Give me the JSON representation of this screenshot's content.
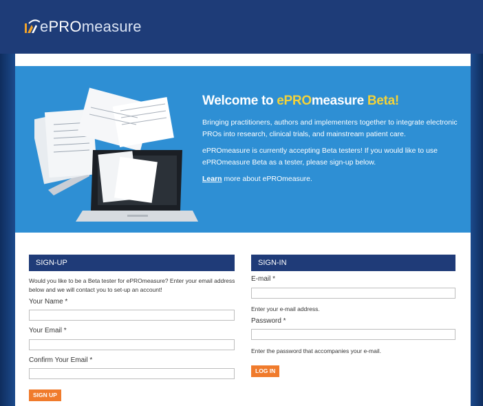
{
  "brand": {
    "name_prefix": "e",
    "name_highlight": "PRO",
    "name_suffix": "measure"
  },
  "hero": {
    "title_white": "Welcome to ",
    "title_yellow_1": "ePRO",
    "title_white_2": "measure ",
    "title_yellow_2": "Beta!",
    "p1": "Bringing practitioners, authors and implementers together to integrate electronic PROs into research, clinical trials, and mainstream patient care.",
    "p2": "ePROmeasure is currently accepting Beta testers! If you would like to use ePROmeasure Beta as a tester, please sign-up below.",
    "learn_link": "Learn",
    "learn_rest": " more about ePROmeasure."
  },
  "signup": {
    "header": "SIGN-UP",
    "intro": "Would you like to be a Beta tester for ePROmeasure? Enter your email address below and we will contact you to set-up an account!",
    "name_label": "Your Name *",
    "email_label": "Your Email *",
    "confirm_label": "Confirm Your Email *",
    "button": "SIGN UP"
  },
  "signin": {
    "header": "SIGN-IN",
    "email_label": "E-mail *",
    "email_help": "Enter your e-mail address.",
    "password_label": "Password *",
    "password_help": "Enter the password that accompanies your e-mail.",
    "button": "LOG IN"
  },
  "colors": {
    "header_bg": "#1e3c78",
    "hero_bg": "#2e8fd4",
    "accent_yellow": "#f2d23a",
    "button_orange": "#f07b2c"
  }
}
